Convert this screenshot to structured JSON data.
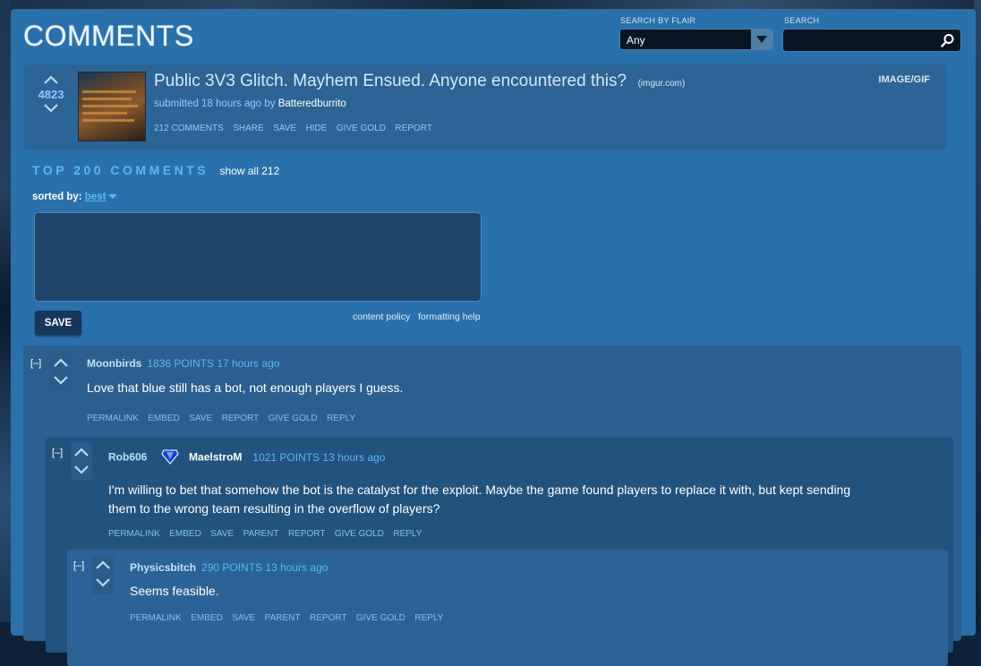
{
  "header": {
    "title": "COMMENTS",
    "flair_label": "SEARCH BY FLAIR",
    "flair_value": "Any",
    "search_label": "SEARCH",
    "search_value": ""
  },
  "post": {
    "score": "4823",
    "title": "Public 3V3 Glitch. Mayhem Ensued. Anyone encountered this?",
    "domain": "(imgur.com)",
    "meta_prefix": "submitted 18 hours ago by",
    "author": "Batteredburrito",
    "flair": "IMAGE/GIF",
    "actions": [
      "212 COMMENTS",
      "SHARE",
      "SAVE",
      "HIDE",
      "GIVE GOLD",
      "REPORT"
    ]
  },
  "comments_section": {
    "heading": "TOP 200 COMMENTS",
    "show_all": "show all 212",
    "sorted_label": "sorted by:",
    "sorted_value": "best",
    "textarea_value": "",
    "save_label": "SAVE",
    "content_policy": "content policy",
    "formatting_help": "formatting help"
  },
  "comments": [
    {
      "collapse": "[–]",
      "user": "Moonbirds",
      "points": "1836 POINTS 17 hours ago",
      "body": "Love that blue still has a bot, not enough players I guess.",
      "actions": [
        "PERMALINK",
        "EMBED",
        "SAVE",
        "REPORT",
        "GIVE GOLD",
        "REPLY"
      ]
    },
    {
      "collapse": "[–]",
      "user": "Rob606",
      "flair_text": "MaelstroM",
      "flair_icon": "diamond-rank-icon",
      "points": "1021 POINTS 13 hours ago",
      "body": "I'm willing to bet that somehow the bot is the catalyst for the exploit. Maybe the game found players to replace it with, but kept sending them to the wrong team resulting in the overflow of players?",
      "actions": [
        "PERMALINK",
        "EMBED",
        "SAVE",
        "PARENT",
        "REPORT",
        "GIVE GOLD",
        "REPLY"
      ]
    },
    {
      "collapse": "[–]",
      "user": "Physicsbitch",
      "points": "290 POINTS 13 hours ago",
      "body": "Seems feasible.",
      "actions": [
        "PERMALINK",
        "EMBED",
        "SAVE",
        "PARENT",
        "REPORT",
        "GIVE GOLD",
        "REPLY"
      ]
    }
  ],
  "colors": {
    "panel": "#2a70aa",
    "accent": "#5ab8f0",
    "link": "#8ecbf4"
  }
}
